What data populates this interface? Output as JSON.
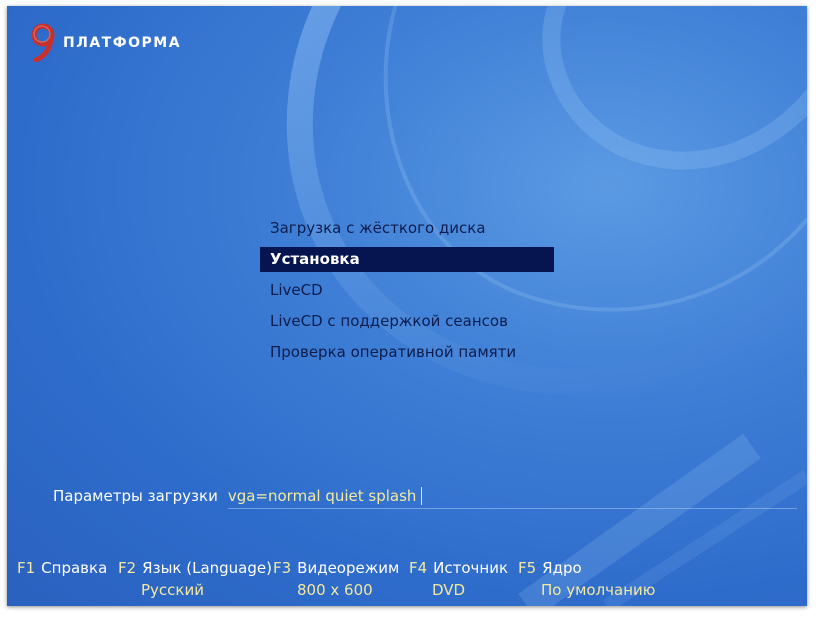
{
  "logo": {
    "text": "ПЛАТФОРМА"
  },
  "menu": {
    "items": [
      {
        "label": "Загрузка с жёсткого диска"
      },
      {
        "label": "Установка"
      },
      {
        "label": "LiveCD"
      },
      {
        "label": "LiveCD с поддержкой сеансов"
      },
      {
        "label": "Проверка оперативной памяти"
      }
    ]
  },
  "boot_params": {
    "label": "Параметры загрузки",
    "value": "vga=normal quiet splash"
  },
  "fkeys": [
    {
      "key": "F1",
      "label": "Справка",
      "value": ""
    },
    {
      "key": "F2",
      "label": "Язык (Language)",
      "value": "Русский"
    },
    {
      "key": "F3",
      "label": "Видеорежим",
      "value": "800 x 600"
    },
    {
      "key": "F4",
      "label": "Источник",
      "value": "DVD"
    },
    {
      "key": "F5",
      "label": "Ядро",
      "value": "По умолчанию"
    }
  ],
  "colors": {
    "background": "#3f7fd6",
    "selection": "#061450",
    "accent_text": "#f3e9a2",
    "menu_text": "#0c1d4d"
  }
}
